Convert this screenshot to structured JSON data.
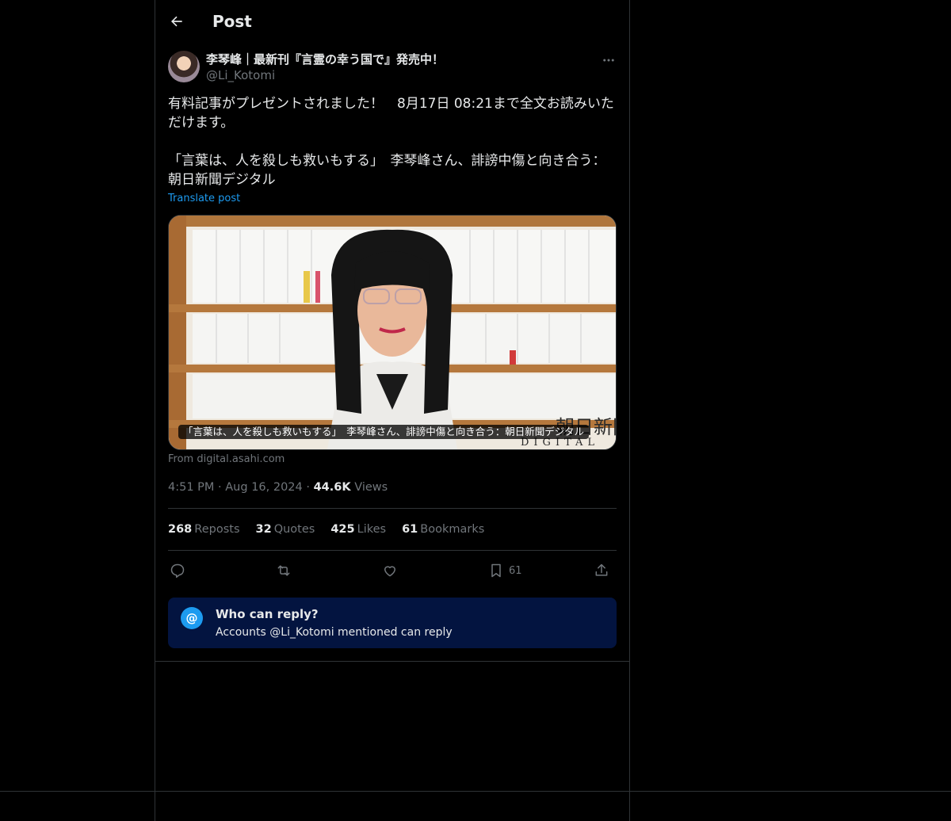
{
  "header": {
    "title": "Post"
  },
  "author": {
    "display_name": "李琴峰｜最新刊『言霊の幸う国で』発売中！",
    "handle": "@Li_Kotomi"
  },
  "tweet": {
    "line1": "有料記事がプレゼントされました！　8月17日 08:21まで全文お読みいただけます。",
    "line2": "「言葉は、人を殺しも救いもする」　李琴峰さん、誹謗中傷と向き合う：朝日新聞デジタル",
    "translate_label": "Translate post"
  },
  "card": {
    "caption": "「言葉は、人を殺しも救いもする」　李琴峰さん、誹謗中傷と向き合う：朝日新聞デジタル",
    "watermark_top": "朝日新聞",
    "watermark_bottom": "DIGITAL",
    "source": "From digital.asahi.com"
  },
  "meta": {
    "time": "4:51 PM",
    "date": "Aug 16, 2024",
    "views_count": "44.6K",
    "views_label": "Views"
  },
  "stats": {
    "reposts_count": "268",
    "reposts_label": "Reposts",
    "quotes_count": "32",
    "quotes_label": "Quotes",
    "likes_count": "425",
    "likes_label": "Likes",
    "bookmarks_count": "61",
    "bookmarks_label": "Bookmarks"
  },
  "actions": {
    "bookmark_count": "61",
    "icons": [
      "reply-icon",
      "repost-icon",
      "like-icon",
      "bookmark-icon",
      "share-icon"
    ]
  },
  "reply_restriction": {
    "icon_glyph": "@",
    "title": "Who can reply?",
    "subtitle": "Accounts @Li_Kotomi mentioned can reply"
  },
  "colors": {
    "background": "#000000",
    "accent": "#1d9bf0",
    "muted": "#71767b",
    "border": "#2f3336",
    "reply_box": "#031440"
  }
}
